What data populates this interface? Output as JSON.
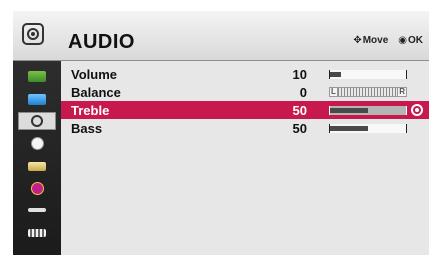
{
  "header": {
    "title": "AUDIO",
    "move_hint": "Move",
    "ok_hint": "OK",
    "move_icon": "four-way-arrow-icon",
    "ok_icon": "ok-button-icon",
    "menu_icon": "speaker-icon"
  },
  "sidebar": {
    "items": [
      {
        "name": "picture",
        "icon": "picture-icon",
        "selected": false
      },
      {
        "name": "screen",
        "icon": "screen-icon",
        "selected": false
      },
      {
        "name": "audio",
        "icon": "speaker-icon",
        "selected": true
      },
      {
        "name": "time",
        "icon": "clock-icon",
        "selected": false
      },
      {
        "name": "setup",
        "icon": "setup-icon",
        "selected": false
      },
      {
        "name": "info",
        "icon": "info-icon",
        "selected": false
      },
      {
        "name": "input",
        "icon": "input-icon",
        "selected": false
      },
      {
        "name": "media",
        "icon": "media-icon",
        "selected": false
      }
    ]
  },
  "settings": [
    {
      "label": "Volume",
      "value": "10",
      "level": 0.15,
      "type": "bar",
      "selected": false
    },
    {
      "label": "Balance",
      "value": "0",
      "left_label": "L",
      "right_label": "R",
      "type": "balance",
      "selected": false
    },
    {
      "label": "Treble",
      "value": "50",
      "level": 0.5,
      "type": "bar",
      "selected": true
    },
    {
      "label": "Bass",
      "value": "50",
      "level": 0.5,
      "type": "bar",
      "selected": false
    }
  ],
  "colors": {
    "highlight": "#c8194e",
    "menu_background": "#e7e7e7",
    "sidebar_background": "#1f1f1f"
  }
}
